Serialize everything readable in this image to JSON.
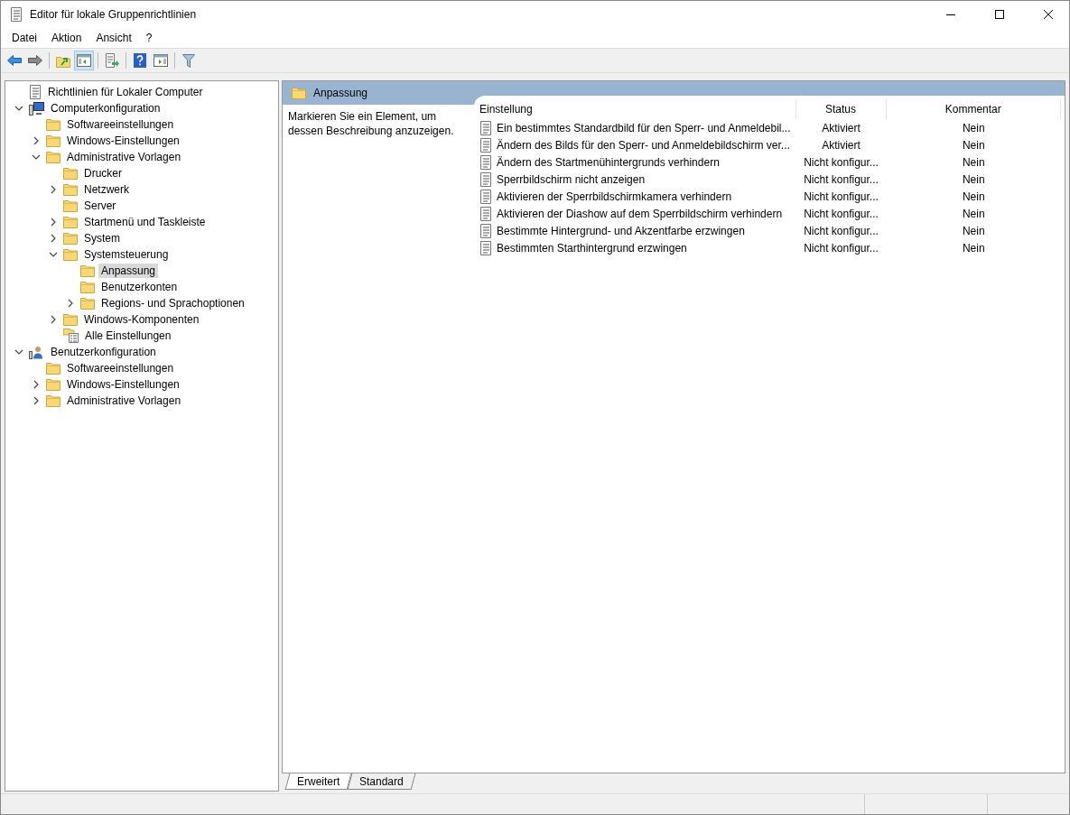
{
  "window": {
    "title": "Editor für lokale Gruppenrichtlinien"
  },
  "menu": [
    "Datei",
    "Aktion",
    "Ansicht",
    "?"
  ],
  "toolbar": [
    {
      "kind": "back",
      "pressed": false
    },
    {
      "kind": "forward",
      "pressed": false
    },
    {
      "kind": "separator"
    },
    {
      "kind": "folder-up",
      "pressed": false
    },
    {
      "kind": "tree-pane",
      "pressed": true
    },
    {
      "kind": "separator"
    },
    {
      "kind": "export",
      "pressed": false
    },
    {
      "kind": "separator"
    },
    {
      "kind": "help",
      "pressed": false
    },
    {
      "kind": "action-pane",
      "pressed": false
    },
    {
      "kind": "separator"
    },
    {
      "kind": "filter",
      "pressed": false
    }
  ],
  "tree": [
    {
      "label": "Richtlinien für Lokaler Computer",
      "kind": "policy",
      "selected": false
    },
    {
      "label": "Computerkonfiguration",
      "kind": "computer",
      "expanded": true,
      "selected": false,
      "children": [
        {
          "label": "Softwareeinstellungen",
          "kind": "folder",
          "selected": false
        },
        {
          "label": "Windows-Einstellungen",
          "kind": "folder",
          "expanded": false,
          "selected": false
        },
        {
          "label": "Administrative Vorlagen",
          "kind": "folder",
          "expanded": true,
          "selected": false,
          "children": [
            {
              "label": "Drucker",
              "kind": "folder",
              "selected": false
            },
            {
              "label": "Netzwerk",
              "kind": "folder",
              "expanded": false,
              "selected": false
            },
            {
              "label": "Server",
              "kind": "folder",
              "selected": false
            },
            {
              "label": "Startmenü und Taskleiste",
              "kind": "folder",
              "expanded": false,
              "selected": false
            },
            {
              "label": "System",
              "kind": "folder",
              "expanded": false,
              "selected": false
            },
            {
              "label": "Systemsteuerung",
              "kind": "folder",
              "expanded": true,
              "selected": false,
              "children": [
                {
                  "label": "Anpassung",
                  "kind": "folder",
                  "selected": true
                },
                {
                  "label": "Benutzerkonten",
                  "kind": "folder",
                  "selected": false
                },
                {
                  "label": "Regions- und Sprachoptionen",
                  "kind": "folder",
                  "expanded": false,
                  "selected": false
                }
              ]
            },
            {
              "label": "Windows-Komponenten",
              "kind": "folder",
              "expanded": false,
              "selected": false
            },
            {
              "label": "Alle Einstellungen",
              "kind": "all-settings",
              "selected": false
            }
          ]
        }
      ]
    },
    {
      "label": "Benutzerkonfiguration",
      "kind": "user",
      "expanded": true,
      "selected": false,
      "children": [
        {
          "label": "Softwareeinstellungen",
          "kind": "folder",
          "selected": false
        },
        {
          "label": "Windows-Einstellungen",
          "kind": "folder",
          "expanded": false,
          "selected": false
        },
        {
          "label": "Administrative Vorlagen",
          "kind": "folder",
          "expanded": false,
          "selected": false
        }
      ]
    }
  ],
  "pane": {
    "title": "Anpassung",
    "description": "Markieren Sie ein Element, um dessen Beschreibung anzuzeigen."
  },
  "table": {
    "columns": [
      "Einstellung",
      "Status",
      "Kommentar"
    ],
    "rows": [
      [
        "Ein bestimmtes Standardbild für den Sperr- und Anmeldebil...",
        "Aktiviert",
        "Nein"
      ],
      [
        "Ändern des Bilds für den Sperr- und Anmeldebildschirm ver...",
        "Aktiviert",
        "Nein"
      ],
      [
        "Ändern des Startmenühintergrunds verhindern",
        "Nicht konfigur...",
        "Nein"
      ],
      [
        "Sperrbildschirm nicht anzeigen",
        "Nicht konfigur...",
        "Nein"
      ],
      [
        "Aktivieren der Sperrbildschirmkamera verhindern",
        "Nicht konfigur...",
        "Nein"
      ],
      [
        "Aktivieren der Diashow auf dem Sperrbildschirm verhindern",
        "Nicht konfigur...",
        "Nein"
      ],
      [
        "Bestimmte Hintergrund- und Akzentfarbe erzwingen",
        "Nicht konfigur...",
        "Nein"
      ],
      [
        "Bestimmten Starthintergrund erzwingen",
        "Nicht konfigur...",
        "Nein"
      ]
    ]
  },
  "view_tabs": [
    {
      "label": "Erweitert",
      "selected": true
    },
    {
      "label": "Standard",
      "selected": false
    }
  ]
}
